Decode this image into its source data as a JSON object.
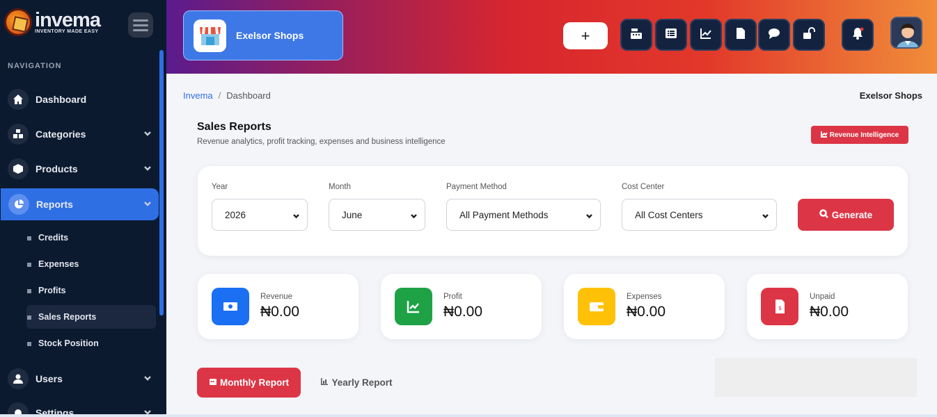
{
  "brand": {
    "name": "invema",
    "tagline": "INVENTORY MADE EASY"
  },
  "sidebar": {
    "heading": "NAVIGATION",
    "items": [
      {
        "label": "Dashboard"
      },
      {
        "label": "Categories"
      },
      {
        "label": "Products"
      },
      {
        "label": "Reports"
      },
      {
        "label": "Users"
      },
      {
        "label": "Settings"
      }
    ],
    "report_subitems": [
      {
        "label": "Credits"
      },
      {
        "label": "Expenses"
      },
      {
        "label": "Profits"
      },
      {
        "label": "Sales Reports"
      },
      {
        "label": "Stock Position"
      }
    ]
  },
  "header": {
    "shop_name": "Exelsor Shops",
    "add_label": "+"
  },
  "breadcrumb": {
    "root": "Invema",
    "separator": "/",
    "current": "Dashboard",
    "right_label": "Exelsor Shops"
  },
  "page": {
    "title": "Sales Reports",
    "subtitle": "Revenue analytics, profit tracking, expenses and business intelligence",
    "revenue_button": "Revenue Intelligence"
  },
  "filters": {
    "year": {
      "label": "Year",
      "value": "2026"
    },
    "month": {
      "label": "Month",
      "value": "June"
    },
    "payment": {
      "label": "Payment Method",
      "value": "All Payment Methods"
    },
    "cost_center": {
      "label": "Cost Center",
      "value": "All Cost Centers"
    },
    "generate_label": "Generate"
  },
  "stats": [
    {
      "label": "Revenue",
      "value": "₦0.00",
      "color": "#1a6ff2"
    },
    {
      "label": "Profit",
      "value": "₦0.00",
      "color": "#1fa246"
    },
    {
      "label": "Expenses",
      "value": "₦0.00",
      "color": "#ffc107"
    },
    {
      "label": "Unpaid",
      "value": "₦0.00",
      "color": "#dc3545"
    }
  ],
  "tabs": {
    "monthly": "Monthly Report",
    "yearly": "Yearly Report"
  },
  "colors": {
    "sidebar_bg": "#0c1a30",
    "accent_blue": "#2f6fe4",
    "accent_red": "#dc3545"
  }
}
